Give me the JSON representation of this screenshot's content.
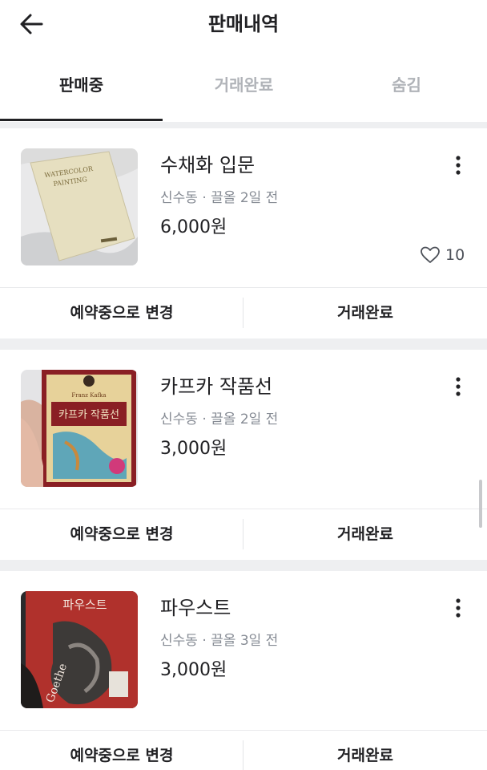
{
  "header": {
    "title": "판매내역",
    "back_icon": "arrow-left-icon"
  },
  "tabs": [
    {
      "label": "판매중",
      "active": true
    },
    {
      "label": "거래완료",
      "active": false
    },
    {
      "label": "숨김",
      "active": false
    }
  ],
  "items": [
    {
      "title": "수채화 입문",
      "location": "신수동",
      "time": "끌올 2일 전",
      "price": "6,000원",
      "likes": "10",
      "thumb_text_1": "WATERCOLOR",
      "thumb_text_2": "PAINTING",
      "reserve_label": "예약중으로 변경",
      "complete_label": "거래완료"
    },
    {
      "title": "카프카 작품선",
      "location": "신수동",
      "time": "끌올 2일 전",
      "price": "3,000원",
      "thumb_text_1": "카프카 작품선",
      "thumb_text_2": "Franz Kafka",
      "reserve_label": "예약중으로 변경",
      "complete_label": "거래완료"
    },
    {
      "title": "파우스트",
      "location": "신수동",
      "time": "끌올 3일 전",
      "price": "3,000원",
      "thumb_text_1": "파우스트",
      "thumb_text_2": "Goethe",
      "reserve_label": "예약중으로 변경",
      "complete_label": "거래완료"
    }
  ],
  "meta_separator": "·",
  "colors": {
    "text": "#212124",
    "muted": "#868b94",
    "tab_inactive": "#b0b3b8",
    "separator": "#eeeff1"
  }
}
